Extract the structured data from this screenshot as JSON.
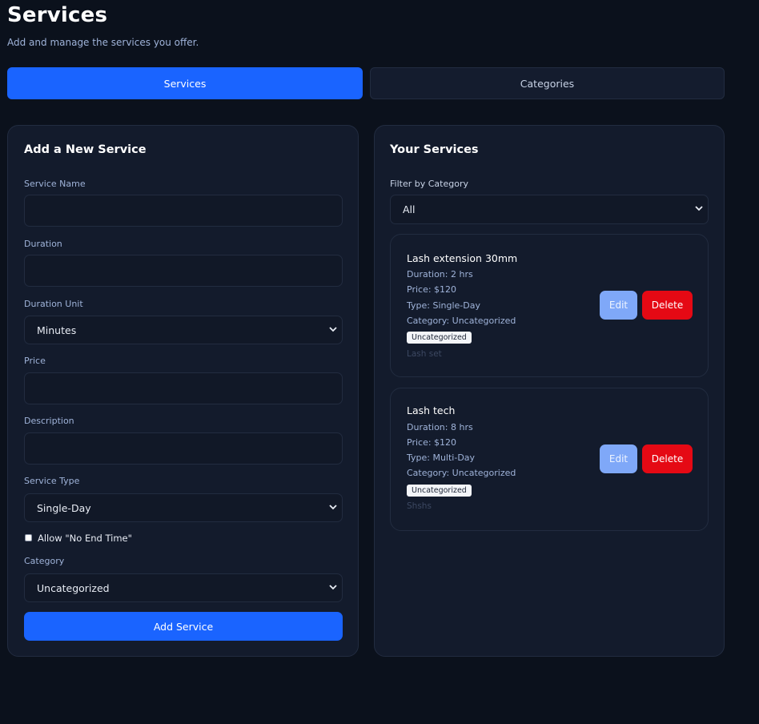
{
  "header": {
    "title": "Services",
    "subtitle": "Add and manage the services you offer."
  },
  "tabs": [
    {
      "label": "Services",
      "active": true
    },
    {
      "label": "Categories",
      "active": false
    }
  ],
  "form": {
    "title": "Add a New Service",
    "service_name_label": "Service Name",
    "service_name_value": "",
    "duration_label": "Duration",
    "duration_value": "",
    "duration_unit_label": "Duration Unit",
    "duration_unit_value": "Minutes",
    "price_label": "Price",
    "price_value": "",
    "description_label": "Description",
    "description_value": "",
    "service_type_label": "Service Type",
    "service_type_value": "Single-Day",
    "no_end_time_label": "Allow \"No End Time\"",
    "no_end_time_checked": false,
    "category_label": "Category",
    "category_value": "Uncategorized",
    "submit_label": "Add Service"
  },
  "list": {
    "title": "Your Services",
    "filter_label": "Filter by Category",
    "filter_value": "All",
    "services": [
      {
        "name": "Lash extension 30mm",
        "duration": "Duration: 2 hrs",
        "price": "Price: $120",
        "type": "Type: Single-Day",
        "category": "Category: Uncategorized",
        "tag": "Uncategorized",
        "description": "Lash set",
        "edit_label": "Edit",
        "delete_label": "Delete"
      },
      {
        "name": "Lash tech",
        "duration": "Duration: 8 hrs",
        "price": "Price: $120",
        "type": "Type: Multi-Day",
        "category": "Category: Uncategorized",
        "tag": "Uncategorized",
        "description": "Shshs",
        "edit_label": "Edit",
        "delete_label": "Delete"
      }
    ]
  },
  "colors": {
    "background": "#0b111c",
    "card": "#131b2c",
    "primary": "#1a64ff",
    "danger": "#e50914",
    "edit": "#7fa8f8"
  },
  "icons": [
    "chevron-down-icon"
  ]
}
